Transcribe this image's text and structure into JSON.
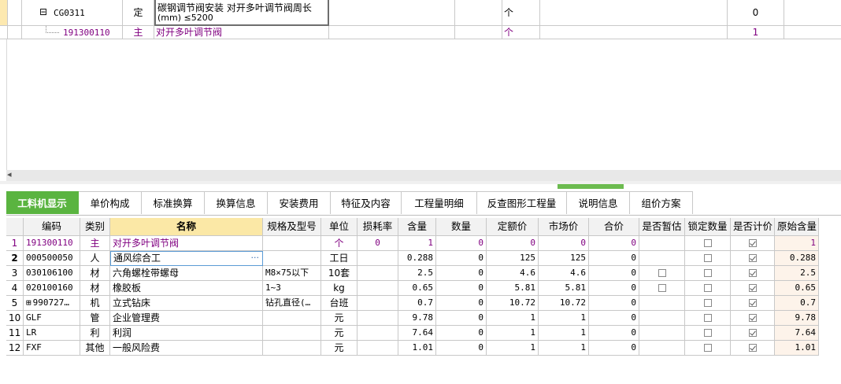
{
  "top_rows": [
    {
      "code": "CG0311",
      "type": "定",
      "name_line1": "碳钢调节阀安装 对开多叶调节阀周长",
      "name_line2": "(mm) ≤5200",
      "unit": "个",
      "qty": "0",
      "expander": "⊟"
    },
    {
      "code": "191300110",
      "type": "主",
      "name": "对开多叶调节阀",
      "unit": "个",
      "qty": "1"
    }
  ],
  "tabs": [
    "工料机显示",
    "单价构成",
    "标准换算",
    "换算信息",
    "安装费用",
    "特征及内容",
    "工程量明细",
    "反查图形工程量",
    "说明信息",
    "组价方案"
  ],
  "active_tab": "工料机显示",
  "columns": [
    "编码",
    "类别",
    "名称",
    "规格及型号",
    "单位",
    "损耗率",
    "含量",
    "数量",
    "定额价",
    "市场价",
    "合价",
    "是否暂估",
    "锁定数量",
    "是否计价",
    "原始含量"
  ],
  "rows": [
    {
      "n": "1",
      "code": "191300110",
      "type": "主",
      "name": "对开多叶调节阀",
      "spec": "",
      "unit": "个",
      "loss": "0",
      "content": "1",
      "qty": "0",
      "price": "0",
      "market": "0",
      "total": "0",
      "est": null,
      "lock": false,
      "priced": true,
      "orig": "1",
      "purple": true
    },
    {
      "n": "2",
      "code": "000500050",
      "type": "人",
      "name": "通风综合工",
      "spec": "",
      "unit": "工日",
      "loss": "",
      "content": "0.288",
      "qty": "0",
      "price": "125",
      "market": "125",
      "total": "0",
      "est": null,
      "lock": false,
      "priced": true,
      "orig": "0.288",
      "editing": true,
      "ellipsis": "···"
    },
    {
      "n": "3",
      "code": "030106100",
      "type": "材",
      "name": "六角螺栓带螺母",
      "spec": "M8×75以下",
      "unit": "10套",
      "loss": "",
      "content": "2.5",
      "qty": "0",
      "price": "4.6",
      "market": "4.6",
      "total": "0",
      "est": false,
      "lock": false,
      "priced": true,
      "orig": "2.5"
    },
    {
      "n": "4",
      "code": "020100160",
      "type": "材",
      "name": "橡胶板",
      "spec": "1~3",
      "unit": "kg",
      "loss": "",
      "content": "0.65",
      "qty": "0",
      "price": "5.81",
      "market": "5.81",
      "total": "0",
      "est": false,
      "lock": false,
      "priced": true,
      "orig": "0.65"
    },
    {
      "n": "5",
      "code": "990727…",
      "type": "机",
      "name": "立式钻床",
      "spec": "钻孔直径(…",
      "unit": "台班",
      "loss": "",
      "content": "0.7",
      "qty": "0",
      "price": "10.72",
      "market": "10.72",
      "total": "0",
      "est": null,
      "lock": false,
      "priced": true,
      "orig": "0.7",
      "expander": "⊞"
    },
    {
      "n": "10",
      "code": "GLF",
      "type": "管",
      "name": "企业管理费",
      "spec": "",
      "unit": "元",
      "loss": "",
      "content": "9.78",
      "qty": "0",
      "price": "1",
      "market": "1",
      "total": "0",
      "est": null,
      "lock": false,
      "priced": true,
      "orig": "9.78"
    },
    {
      "n": "11",
      "code": "LR",
      "type": "利",
      "name": "利润",
      "spec": "",
      "unit": "元",
      "loss": "",
      "content": "7.64",
      "qty": "0",
      "price": "1",
      "market": "1",
      "total": "0",
      "est": null,
      "lock": false,
      "priced": true,
      "orig": "7.64"
    },
    {
      "n": "12",
      "code": "FXF",
      "type": "其他",
      "name": "一般风险费",
      "spec": "",
      "unit": "元",
      "loss": "",
      "content": "1.01",
      "qty": "0",
      "price": "1",
      "market": "1",
      "total": "0",
      "est": null,
      "lock": false,
      "priced": true,
      "orig": "1.01"
    }
  ],
  "scroll_left_arrow": "◂",
  "colors": {
    "tab_active": "#5ab440",
    "header_selected": "#fbe8a6",
    "purple": "#800080",
    "orig_col": "#fdf3ea"
  }
}
